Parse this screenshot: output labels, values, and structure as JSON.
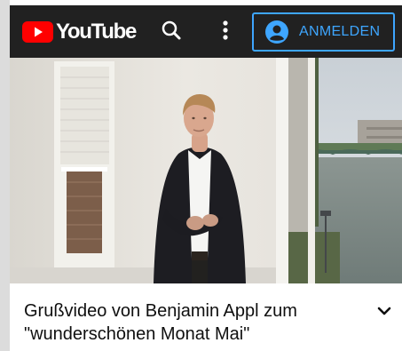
{
  "header": {
    "brand": "YouTube",
    "brand_color": "#ff0000",
    "background": "#212121",
    "search_icon": "search-icon",
    "more_icon": "more-vert-icon",
    "signin": {
      "label": "ANMELDEN",
      "icon": "account-circle-icon",
      "color": "#3ea6ff"
    }
  },
  "player": {
    "scene": "video-frame"
  },
  "video": {
    "title": "Grußvideo von Benjamin Appl zum\n\"wunderschönen Monat Mai\"",
    "expand_icon": "chevron-down-icon"
  }
}
